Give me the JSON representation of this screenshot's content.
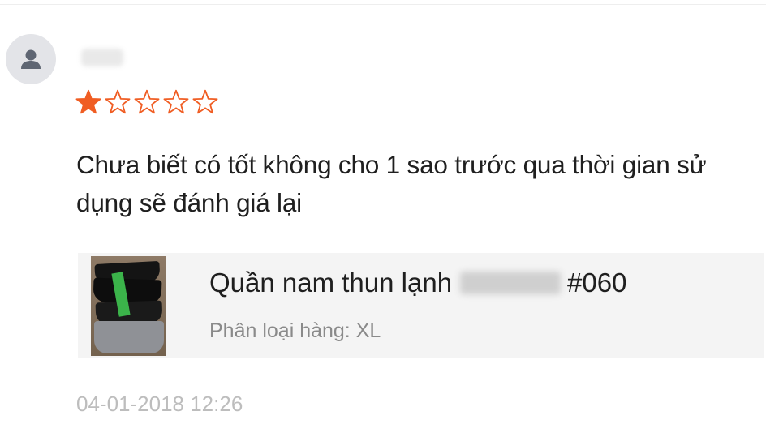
{
  "review": {
    "rating": 1,
    "rating_max": 5,
    "star_color": "#f05d23",
    "avatar_icon": "user-icon",
    "text": "Chưa biết có tốt không  cho 1 sao trước qua thời gian sử dụng sẽ đánh giá lại",
    "timestamp": "04-01-2018 12:26"
  },
  "product": {
    "name_prefix": "Quần nam thun lạnh",
    "name_suffix": "#060",
    "variant": "Phân loại hàng: XL"
  }
}
